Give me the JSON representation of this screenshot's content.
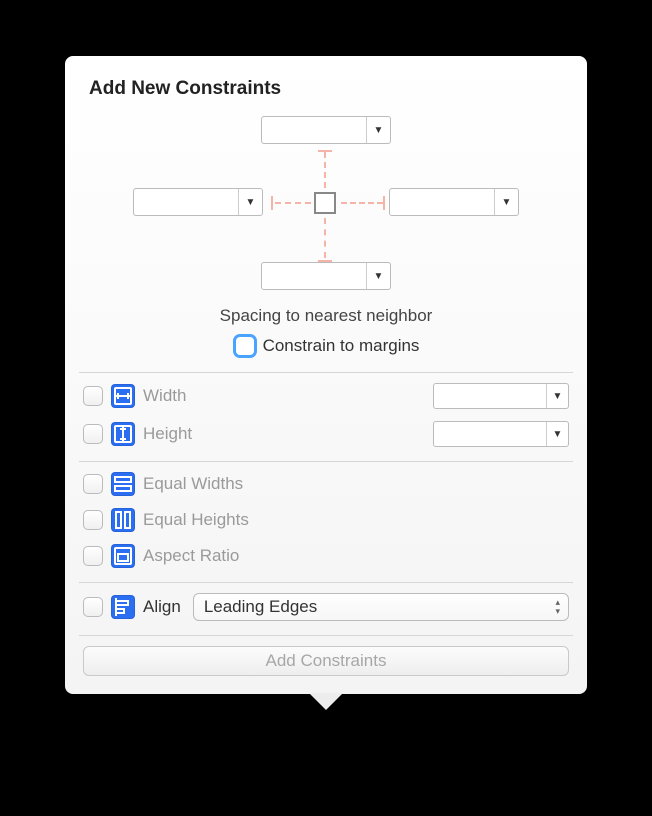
{
  "title": "Add New Constraints",
  "spacing": {
    "top": "",
    "bottom": "",
    "left": "",
    "right": "",
    "label": "Spacing to nearest neighbor"
  },
  "constrain_margins_label": "Constrain to margins",
  "size": {
    "width_label": "Width",
    "height_label": "Height",
    "width_value": "",
    "height_value": ""
  },
  "equal": {
    "widths_label": "Equal Widths",
    "heights_label": "Equal Heights",
    "aspect_label": "Aspect Ratio"
  },
  "align": {
    "label": "Align",
    "selected": "Leading Edges"
  },
  "add_button_label": "Add Constraints"
}
